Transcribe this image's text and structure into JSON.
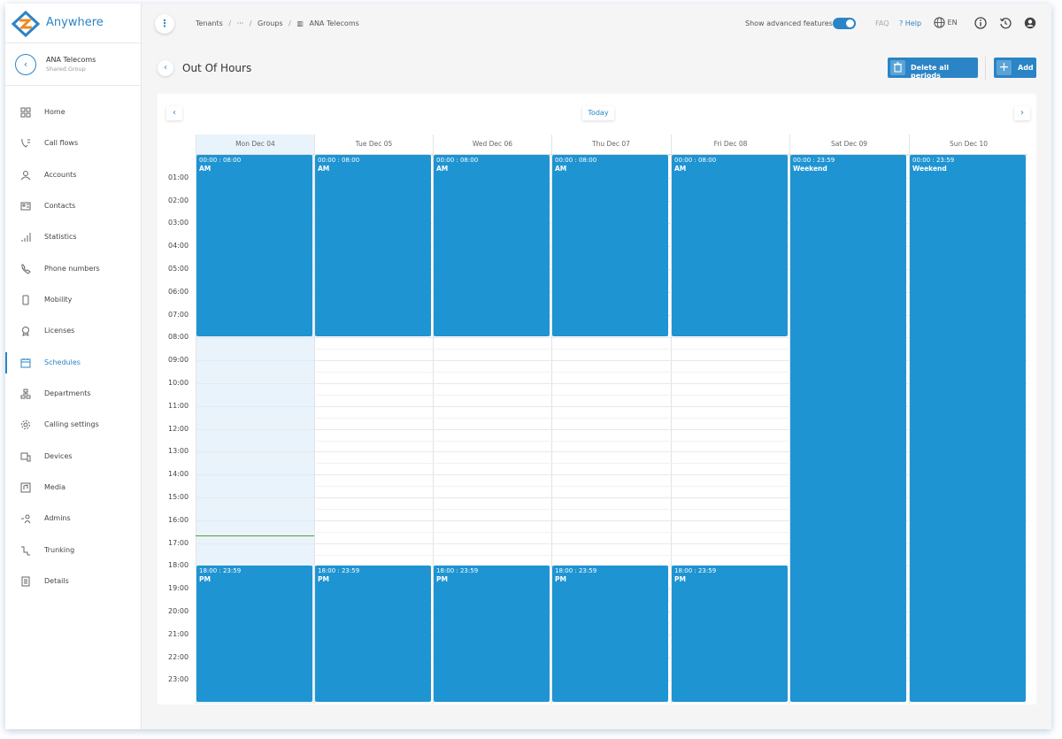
{
  "app": {
    "name": "Anywhere"
  },
  "group": {
    "name": "ANA Telecoms",
    "subtitle": "Shared.Group"
  },
  "sidebar": {
    "items": [
      {
        "label": "Home",
        "icon": "home-icon"
      },
      {
        "label": "Call flows",
        "icon": "call-flows-icon"
      },
      {
        "label": "Accounts",
        "icon": "accounts-icon"
      },
      {
        "label": "Contacts",
        "icon": "contacts-icon"
      },
      {
        "label": "Statistics",
        "icon": "statistics-icon"
      },
      {
        "label": "Phone numbers",
        "icon": "phone-icon"
      },
      {
        "label": "Mobility",
        "icon": "mobile-icon"
      },
      {
        "label": "Licenses",
        "icon": "license-icon"
      },
      {
        "label": "Schedules",
        "icon": "calendar-icon",
        "active": true
      },
      {
        "label": "Departments",
        "icon": "departments-icon"
      },
      {
        "label": "Calling settings",
        "icon": "gear-icon"
      },
      {
        "label": "Devices",
        "icon": "devices-icon"
      },
      {
        "label": "Media",
        "icon": "media-icon"
      },
      {
        "label": "Admins",
        "icon": "admins-icon"
      },
      {
        "label": "Trunking",
        "icon": "trunking-icon"
      },
      {
        "label": "Details",
        "icon": "details-icon"
      }
    ]
  },
  "topbar": {
    "breadcrumb": [
      "Tenants",
      "···",
      "Groups",
      "ANA Telecoms"
    ],
    "advanced_label": "Show advanced features",
    "advanced_enabled": true,
    "faq": "FAQ",
    "help": "? Help",
    "language": "EN"
  },
  "page": {
    "title": "Out Of Hours",
    "delete_label": "Delete all periods",
    "add_label": "Add"
  },
  "calendar": {
    "today_label": "Today",
    "days": [
      "Mon Dec 04",
      "Tue Dec 05",
      "Wed Dec 06",
      "Thu Dec 07",
      "Fri Dec 08",
      "Sat Dec 09",
      "Sun Dec 10"
    ],
    "today_index": 0,
    "hours": [
      "01:00",
      "02:00",
      "03:00",
      "04:00",
      "05:00",
      "06:00",
      "07:00",
      "08:00",
      "09:00",
      "10:00",
      "11:00",
      "12:00",
      "13:00",
      "14:00",
      "15:00",
      "16:00",
      "17:00",
      "18:00",
      "19:00",
      "20:00",
      "21:00",
      "22:00",
      "23:00"
    ],
    "now_time": "16:40",
    "events": [
      {
        "day": 0,
        "start": "00:00",
        "end": "08:00",
        "time": "00:00 : 08:00",
        "name": "AM"
      },
      {
        "day": 1,
        "start": "00:00",
        "end": "08:00",
        "time": "00:00 : 08:00",
        "name": "AM"
      },
      {
        "day": 2,
        "start": "00:00",
        "end": "08:00",
        "time": "00:00 : 08:00",
        "name": "AM"
      },
      {
        "day": 3,
        "start": "00:00",
        "end": "08:00",
        "time": "00:00 : 08:00",
        "name": "AM"
      },
      {
        "day": 4,
        "start": "00:00",
        "end": "08:00",
        "time": "00:00 : 08:00",
        "name": "AM"
      },
      {
        "day": 5,
        "start": "00:00",
        "end": "23:59",
        "time": "00:00 : 23:59",
        "name": "Weekend"
      },
      {
        "day": 6,
        "start": "00:00",
        "end": "23:59",
        "time": "00:00 : 23:59",
        "name": "Weekend"
      },
      {
        "day": 0,
        "start": "18:00",
        "end": "23:59",
        "time": "18:00 : 23:59",
        "name": "PM"
      },
      {
        "day": 1,
        "start": "18:00",
        "end": "23:59",
        "time": "18:00 : 23:59",
        "name": "PM"
      },
      {
        "day": 2,
        "start": "18:00",
        "end": "23:59",
        "time": "18:00 : 23:59",
        "name": "PM"
      },
      {
        "day": 3,
        "start": "18:00",
        "end": "23:59",
        "time": "18:00 : 23:59",
        "name": "PM"
      },
      {
        "day": 4,
        "start": "18:00",
        "end": "23:59",
        "time": "18:00 : 23:59",
        "name": "PM"
      }
    ]
  },
  "colors": {
    "accent": "#2a84c6",
    "event": "#1f94d2",
    "today_bg": "#e9f3fb",
    "now_line": "#5a9e3a"
  }
}
